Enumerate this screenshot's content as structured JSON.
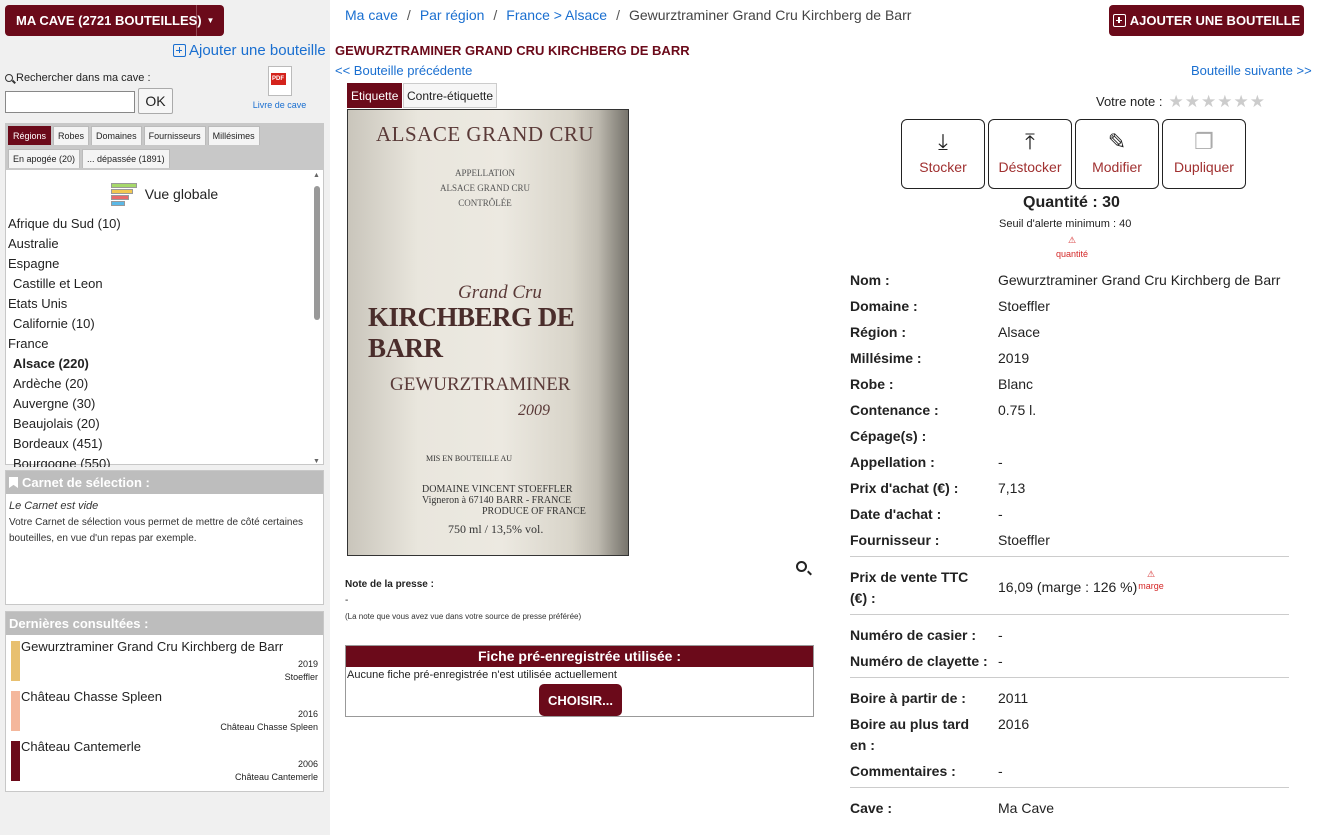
{
  "sidebar": {
    "cave_button": "MA CAVE (2721 BOUTEILLES)",
    "add_link": "Ajouter une bouteille",
    "search_label": "Rechercher dans ma cave :",
    "search_value": "",
    "ok_label": "OK",
    "pdf_label": "Livre de cave",
    "tabs": [
      "Régions",
      "Robes",
      "Domaines",
      "Fournisseurs",
      "Millésimes",
      "En apogée (20)",
      "... dépassée (1891)"
    ],
    "global_view": "Vue globale",
    "regions": [
      "Afrique du Sud (10)",
      "Australie",
      "Espagne",
      "Castille et Leon",
      "Etats Unis",
      "Californie (10)",
      "France",
      "Alsace (220)",
      "Ardèche (20)",
      "Auvergne (30)",
      "Beaujolais (20)",
      "Bordeaux (451)",
      "Bourgogne (550)"
    ],
    "carnet": {
      "title": "Carnet de sélection :",
      "empty": "Le Carnet est vide",
      "text": "Votre Carnet de sélection vous permet de mettre de côté certaines bouteilles, en vue d'un repas par exemple."
    },
    "dernieres": {
      "title": "Dernières consultées :",
      "items": [
        {
          "name": "Gewurztraminer Grand Cru Kirchberg de Barr",
          "year": "2019",
          "domain": "Stoeffler",
          "color": "#e8c070"
        },
        {
          "name": "Château Chasse Spleen",
          "year": "2016",
          "domain": "Château Chasse Spleen",
          "color": "#f4b79c"
        },
        {
          "name": "Château Cantemerle",
          "year": "2006",
          "domain": "Château Cantemerle",
          "color": "#6b0a1a"
        }
      ]
    }
  },
  "breadcrumb": {
    "items": [
      "Ma cave",
      "Par région",
      "France > Alsace"
    ],
    "current": "Gewurztraminer Grand Cru Kirchberg de Barr"
  },
  "top_add_button": "AJOUTER UNE BOUTEILLE",
  "bottle": {
    "title": "GEWURZTRAMINER GRAND CRU KIRCHBERG DE BARR",
    "prev": "<< Bouteille précédente",
    "next": "Bouteille suivante >>",
    "image_tabs": [
      "Etiquette",
      "Contre-étiquette"
    ],
    "label_text": {
      "line1": "ALSACE GRAND CRU",
      "line2a": "APPELLATION",
      "line2b": "ALSACE GRAND CRU",
      "line2c": "CONTRÔLÉE",
      "line3": "Grand Cru",
      "line4": "KIRCHBERG DE BARR",
      "line5": "GEWURZTRAMINER",
      "line6": "2009",
      "line7": "MIS EN BOUTEILLE AU",
      "line8a": "DOMAINE VINCENT STOEFFLER",
      "line8b": "Vigneron à 67140 BARR - FRANCE",
      "line8c": "PRODUCE OF FRANCE",
      "line9": "750 ml / 13,5% vol."
    },
    "press_title": "Note de la presse :",
    "press_value": "-",
    "press_hint": "(La note que vous avez vue dans votre source de presse préférée)",
    "fiche_title": "Fiche pré-enregistrée utilisée :",
    "fiche_text": "Aucune fiche pré-enregistrée n'est utilisée actuellement",
    "fiche_button": "CHOISIR...",
    "rating_label": "Votre note :",
    "actions": [
      "Stocker",
      "Déstocker",
      "Modifier",
      "Dupliquer"
    ],
    "quantity": "Quantité : 30",
    "alert_threshold": "Seuil d'alerte minimum : 40",
    "warn_quantity": "quantité",
    "warn_margin": "marge",
    "fields": [
      {
        "label": "Nom :",
        "value": "Gewurztraminer Grand Cru Kirchberg de Barr"
      },
      {
        "label": "Domaine :",
        "value": "Stoeffler"
      },
      {
        "label": "Région :",
        "value": "Alsace"
      },
      {
        "label": "Millésime :",
        "value": "2019"
      },
      {
        "label": "Robe :",
        "value": "Blanc"
      },
      {
        "label": "Contenance :",
        "value": "0.75 l."
      },
      {
        "label": "Cépage(s) :",
        "value": ""
      },
      {
        "label": "Appellation :",
        "value": "-"
      },
      {
        "label": "Prix d'achat (€) :",
        "value": "7,13"
      },
      {
        "label": "Date d'achat :",
        "value": "-"
      },
      {
        "label": "Fournisseur :",
        "value": "Stoeffler"
      },
      {
        "label": "Prix de vente TTC (€) :",
        "value": "16,09 (marge : 126 %)"
      },
      {
        "label": "Numéro de casier :",
        "value": "-"
      },
      {
        "label": "Numéro de clayette :",
        "value": "-"
      },
      {
        "label": "Boire à partir de :",
        "value": "2011"
      },
      {
        "label": "Boire au plus tard en :",
        "value": "2016"
      },
      {
        "label": "Commentaires :",
        "value": "-"
      },
      {
        "label": "Cave :",
        "value": "Ma Cave"
      }
    ]
  },
  "colors": {
    "brand": "#6b0a1a",
    "link": "#1a6fd0",
    "warn": "#d42828"
  }
}
